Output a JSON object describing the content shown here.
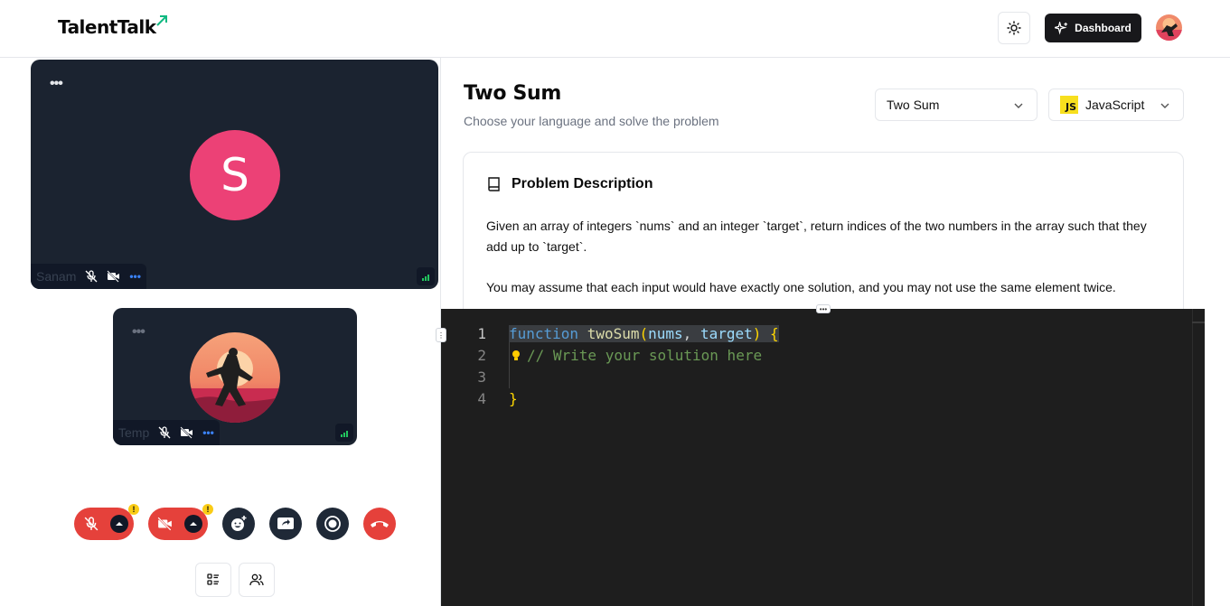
{
  "header": {
    "logo": "TalentTalk",
    "dashboard_label": "Dashboard"
  },
  "participants": [
    {
      "name": "Sanam",
      "initial": "S",
      "avatar_color": "#ec4176"
    },
    {
      "name": "Temp"
    }
  ],
  "tile_menu": "•••",
  "controls": {
    "warn_badge": "!"
  },
  "problem": {
    "title": "Two Sum",
    "subtitle": "Choose your language and solve the problem",
    "problem_select": "Two Sum",
    "language_select": "JavaScript",
    "language_badge": "JS",
    "description_heading": "Problem Description",
    "paragraphs": [
      "Given an array of integers `nums` and an integer `target`, return indices of the two numbers in the array such that they add up to `target`.",
      "You may assume that each input would have exactly one solution, and you may not use the same element twice."
    ]
  },
  "editor": {
    "line_numbers": [
      "1",
      "2",
      "3",
      "4"
    ],
    "code": {
      "keyword": "function",
      "fn_name": "twoSum",
      "open_paren": "(",
      "param1": "nums",
      "comma": ", ",
      "param2": "target",
      "close_paren": ")",
      "open_brace": "{",
      "comment": "// Write your solution here",
      "close_brace": "}"
    }
  },
  "colors": {
    "accent_dark": "#18181b",
    "end_call_red": "#e5413b",
    "editor_bg": "#1e1e1e",
    "logo_arrow": "#10b981"
  }
}
